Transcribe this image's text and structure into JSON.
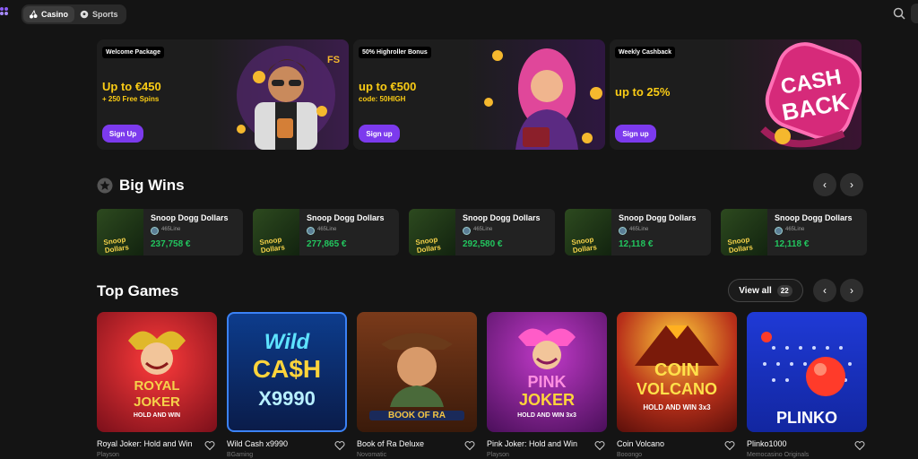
{
  "nav": {
    "tabs": [
      {
        "label": "Casino"
      },
      {
        "label": "Sports"
      }
    ]
  },
  "promos": [
    {
      "tag": "Welcome Package",
      "amount": "Up to €450",
      "sub": "+ 250 Free Spins",
      "button": "Sign Up"
    },
    {
      "tag": "50% Highroller Bonus",
      "amount": "up to €500",
      "sub": "code: 50HIGH",
      "button": "Sign up"
    },
    {
      "tag": "Weekly Cashback",
      "amount": "up to 25%",
      "sub": "",
      "button": "Sign up"
    }
  ],
  "promo_art": {
    "cashback_line1": "CASH",
    "cashback_line2": "BACK",
    "fs": "FS"
  },
  "big_wins": {
    "title": "Big Wins",
    "items": [
      {
        "game": "Snoop Dogg Dollars",
        "user": "465Line",
        "amount": "237,758 €"
      },
      {
        "game": "Snoop Dogg Dollars",
        "user": "465Line",
        "amount": "277,865 €"
      },
      {
        "game": "Snoop Dogg Dollars",
        "user": "465Line",
        "amount": "292,580 €"
      },
      {
        "game": "Snoop Dogg Dollars",
        "user": "465Line",
        "amount": "12,118 €"
      },
      {
        "game": "Snoop Dogg Dollars",
        "user": "465Line",
        "amount": "12,118 €"
      }
    ],
    "thumb_text": "Snoop Dollars"
  },
  "top_games": {
    "title": "Top Games",
    "view_all": "View all",
    "count": "22",
    "items": [
      {
        "title": "Royal Joker: Hold and Win",
        "provider": "Playson",
        "cover_line1": "ROYAL",
        "cover_line2": "JOKER",
        "cover_line3": "HOLD AND WIN"
      },
      {
        "title": "Wild Cash x9990",
        "provider": "BGaming",
        "cover_line1": "Wild",
        "cover_line2": "CA$H",
        "cover_line3": "X9990"
      },
      {
        "title": "Book of Ra Deluxe",
        "provider": "Novomatic",
        "cover_line1": "",
        "cover_line2": "",
        "cover_line3": "BOOK OF RA"
      },
      {
        "title": "Pink Joker: Hold and Win",
        "provider": "Playson",
        "cover_line1": "PINK",
        "cover_line2": "JOKER",
        "cover_line3": "HOLD AND WIN 3x3"
      },
      {
        "title": "Coin Volcano",
        "provider": "Booongo",
        "cover_line1": "COIN",
        "cover_line2": "VOLCANO",
        "cover_line3": "HOLD AND WIN 3x3"
      },
      {
        "title": "Plinko1000",
        "provider": "Memocasino Originals",
        "cover_line1": "",
        "cover_line2": "",
        "cover_line3": "PLINKO"
      }
    ]
  },
  "colors": {
    "accent": "#7c3aed",
    "bonus_text": "#facc15",
    "win_amount": "#22c55e",
    "background": "#141414"
  }
}
